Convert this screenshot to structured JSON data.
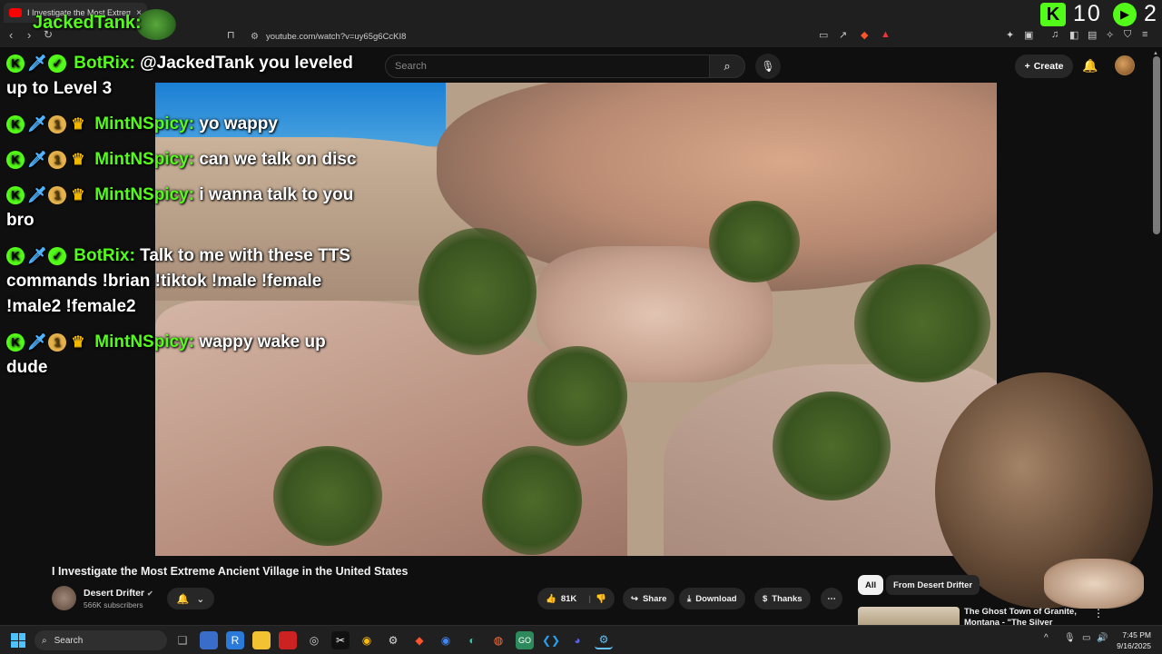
{
  "browser": {
    "tab_title": "I Investigate the Most Extreme",
    "url": "youtube.com/watch?v=uy65g6CcKI8"
  },
  "youtube": {
    "search_placeholder": "Search",
    "create_label": "Create"
  },
  "stream_overlay": {
    "top_user": "JackedTank:",
    "kick_count": "10",
    "play_count": "2"
  },
  "chat": [
    {
      "user": "BotRix:",
      "badges": [
        "kick-icon",
        "sword-icon",
        "verified-icon"
      ],
      "text": "@JackedTank you leveled up to Level 3"
    },
    {
      "user": "MintNSpicy:",
      "badges": [
        "kick-icon",
        "sword-icon",
        "one-icon",
        "crown-icon"
      ],
      "text": "yo wappy"
    },
    {
      "user": "MintNSpicy:",
      "badges": [
        "kick-icon",
        "sword-icon",
        "one-icon",
        "crown-icon"
      ],
      "text": "can we talk on disc"
    },
    {
      "user": "MintNSpicy:",
      "badges": [
        "kick-icon",
        "sword-icon",
        "one-icon",
        "crown-icon"
      ],
      "text": "i wanna talk to you bro"
    },
    {
      "user": "BotRix:",
      "badges": [
        "kick-icon",
        "sword-icon",
        "verified-icon"
      ],
      "text": "Talk to me with these TTS commands !brian !tiktok !male !female !male2 !female2"
    },
    {
      "user": "MintNSpicy:",
      "badges": [
        "kick-icon",
        "sword-icon",
        "one-icon",
        "crown-icon"
      ],
      "text": "wappy wake up dude"
    }
  ],
  "video": {
    "title": "I Investigate the Most Extreme Ancient Village in the United States",
    "channel": "Desert Drifter",
    "subscribers": "566K subscribers",
    "likes": "81K",
    "share_label": "Share",
    "download_label": "Download",
    "thanks_label": "Thanks"
  },
  "sidebar": {
    "chips": [
      "All",
      "From Desert Drifter"
    ],
    "rec_title": "The Ghost Town of Granite, Montana - \"The Silver Queen\""
  },
  "taskbar": {
    "search_placeholder": "Search",
    "time": "7:45 PM",
    "date": "9/16/2025"
  },
  "colors": {
    "kick_green": "#53fc18",
    "youtube_bg": "#0f0f0f",
    "brave_orange": "#fb542b"
  }
}
